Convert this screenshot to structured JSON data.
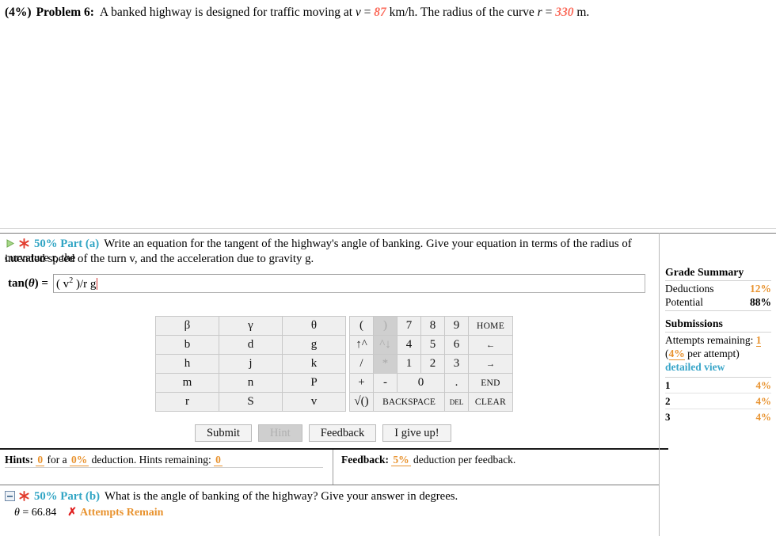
{
  "problem": {
    "weight": "(4%)",
    "label": "Problem 6:",
    "text_pre": "A banked highway is designed for traffic moving at ",
    "var_v": "v",
    "eq1": " = ",
    "value_v": "87",
    "text_mid": " km/h. The radius of the curve ",
    "var_r": "r",
    "eq2": " = ",
    "value_r": "330",
    "text_end": " m."
  },
  "part_a": {
    "percent": "50%",
    "name": "Part (a)",
    "question_line1": "Write an equation for the tangent of the highway's angle of banking. Give your equation in terms of the radius of curvature r, the",
    "question_line2": "intended speed of the turn v, and the acceleration due to gravity g.",
    "answer_label_pre": "tan(",
    "answer_label_theta": "θ",
    "answer_label_post": ") =",
    "answer_value_a": "( v",
    "answer_value_sup": "2",
    "answer_value_b": " )/r g"
  },
  "keypad": {
    "left_rows": [
      [
        "β",
        "γ",
        "θ"
      ],
      [
        "b",
        "d",
        "g"
      ],
      [
        "h",
        "j",
        "k"
      ],
      [
        "m",
        "n",
        "P"
      ],
      [
        "r",
        "S",
        "v"
      ]
    ],
    "right_row1": [
      "(",
      ")",
      "7",
      "8",
      "9",
      "HOME"
    ],
    "right_row2": [
      "↑^",
      "^↓",
      "4",
      "5",
      "6",
      "←"
    ],
    "right_row3": [
      "/",
      "*",
      "1",
      "2",
      "3",
      "→"
    ],
    "right_row4": [
      "+",
      "-",
      "0",
      ".",
      "END"
    ],
    "right_row5": [
      "√()",
      "BACKSPACE",
      "DEL",
      "CLEAR"
    ],
    "disabled_keys": [
      ")",
      "^↓",
      "*"
    ]
  },
  "buttons": {
    "submit": "Submit",
    "hint": "Hint",
    "feedback": "Feedback",
    "give_up": "I give up!"
  },
  "hints_bar": {
    "label": "Hints:",
    "count": "0",
    "for_a": "for a",
    "deduction_pct": "0%",
    "deduction_word": "deduction. Hints remaining:",
    "remaining": "0"
  },
  "feedback_bar": {
    "label": "Feedback:",
    "pct": "5%",
    "text": "deduction per feedback."
  },
  "grade_summary": {
    "title": "Grade Summary",
    "deductions_label": "Deductions",
    "deductions_value": "12%",
    "potential_label": "Potential",
    "potential_value": "88%"
  },
  "submissions": {
    "title": "Submissions",
    "attempts_label": "Attempts remaining:",
    "attempts_value": "1",
    "per_attempt_open": "(",
    "per_attempt_pct": "4%",
    "per_attempt_close": " per attempt)",
    "detailed_view": "detailed view",
    "rows": [
      {
        "n": "1",
        "v": "4%"
      },
      {
        "n": "2",
        "v": "4%"
      },
      {
        "n": "3",
        "v": "4%"
      }
    ]
  },
  "part_b": {
    "percent": "50%",
    "name": "Part (b)",
    "question": "What is the angle of banking of the highway? Give your answer in degrees.",
    "result_theta": "θ",
    "result_eq": " = 66.84",
    "result_mark": "✗",
    "result_status": "Attempts Remain"
  },
  "colors": {
    "accent_blue": "#31a5c4",
    "accent_orange": "#e8922e",
    "value_red": "#fb6b5b",
    "error_red": "#e02020"
  }
}
